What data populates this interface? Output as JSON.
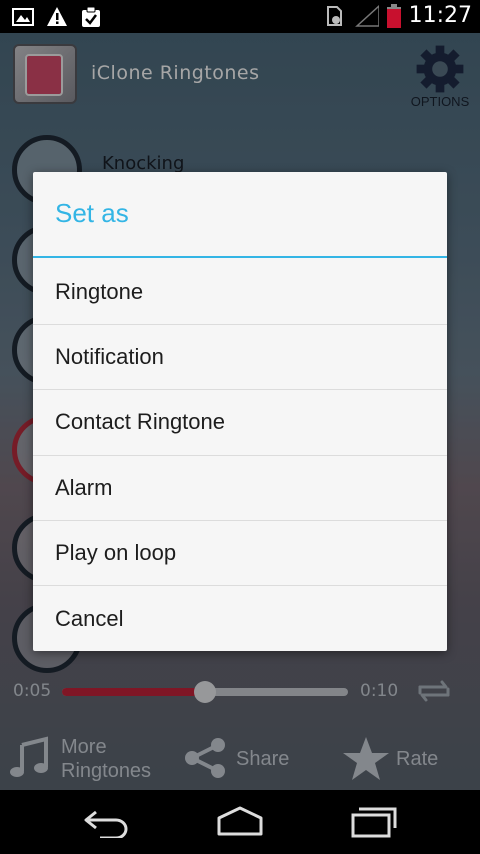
{
  "status_bar": {
    "time": "11:27",
    "icons_left": [
      "image-icon",
      "warning-icon",
      "clipboard-check-icon"
    ],
    "icons_right": [
      "sim-icon",
      "signal-icon",
      "battery-icon"
    ]
  },
  "app": {
    "title": "iClone Ringtones",
    "options_label": "OPTIONS",
    "background_item_title": "Knocking",
    "player": {
      "current_time": "0:05",
      "total_time": "0:10",
      "progress": 0.5
    },
    "actions": {
      "more_line1": "More",
      "more_line2": "Ringtones",
      "share": "Share",
      "rate": "Rate"
    },
    "colors": {
      "accent": "#33b5e5",
      "progress_red": "#c4233a"
    }
  },
  "dialog": {
    "title": "Set as",
    "items": [
      "Ringtone",
      "Notification",
      "Contact Ringtone",
      "Alarm",
      "Play on loop",
      "Cancel"
    ]
  },
  "nav_bar": {
    "buttons": [
      "back-icon",
      "home-icon",
      "recent-apps-icon"
    ]
  }
}
